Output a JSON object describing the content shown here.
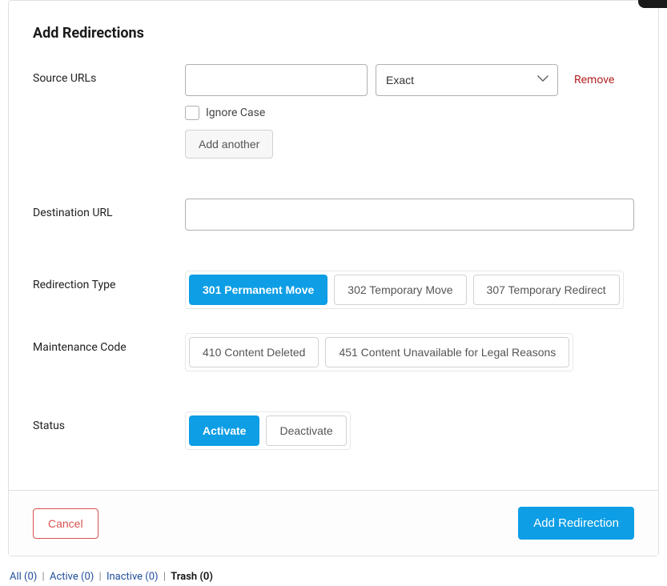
{
  "page": {
    "title": "Add Redirections"
  },
  "source": {
    "label": "Source URLs",
    "url_value": "",
    "match_selected": "Exact",
    "remove_label": "Remove",
    "ignore_case_label": "Ignore Case",
    "ignore_case_checked": false,
    "add_another_label": "Add another"
  },
  "destination": {
    "label": "Destination URL",
    "value": ""
  },
  "redirection_type": {
    "label": "Redirection Type",
    "options": [
      {
        "label": "301 Permanent Move",
        "active": true
      },
      {
        "label": "302 Temporary Move",
        "active": false
      },
      {
        "label": "307 Temporary Redirect",
        "active": false
      }
    ]
  },
  "maintenance_code": {
    "label": "Maintenance Code",
    "options": [
      {
        "label": "410 Content Deleted",
        "active": false
      },
      {
        "label": "451 Content Unavailable for Legal Reasons",
        "active": false
      }
    ]
  },
  "status": {
    "label": "Status",
    "options": [
      {
        "label": "Activate",
        "active": true
      },
      {
        "label": "Deactivate",
        "active": false
      }
    ]
  },
  "footer": {
    "cancel_label": "Cancel",
    "submit_label": "Add Redirection"
  },
  "tabs": [
    {
      "label": "All (0)",
      "current": false
    },
    {
      "label": "Active (0)",
      "current": false
    },
    {
      "label": "Inactive (0)",
      "current": false
    },
    {
      "label": "Trash (0)",
      "current": true
    }
  ]
}
